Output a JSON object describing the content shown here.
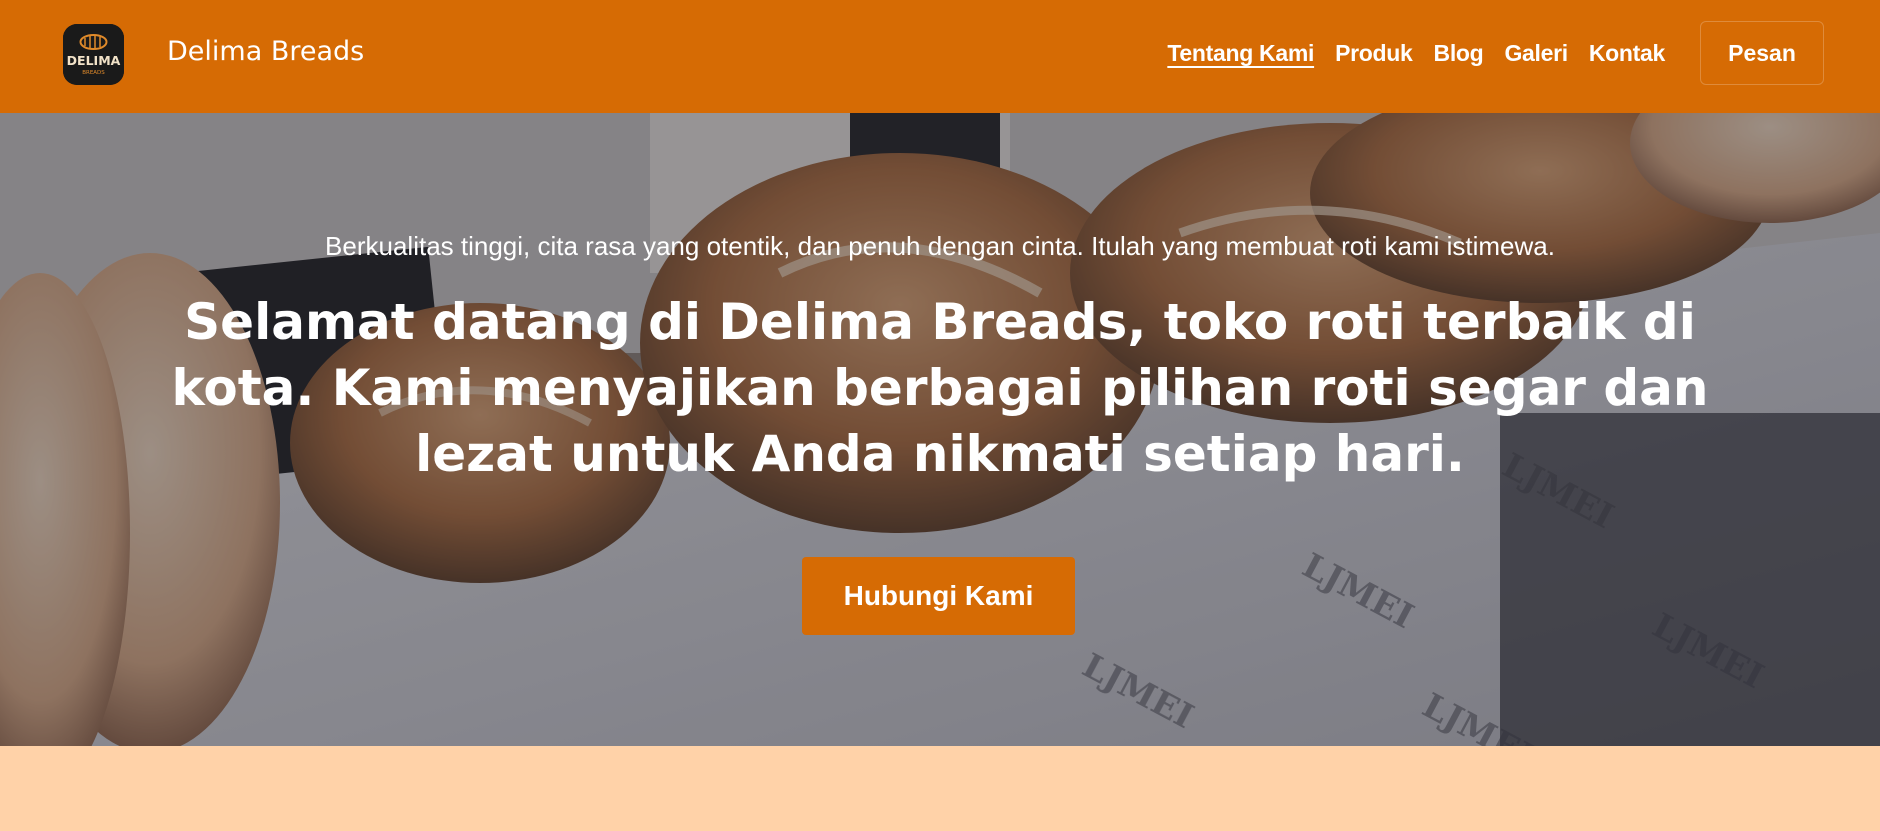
{
  "navbar": {
    "brand": "Delima Breads",
    "logo_text": "DELIMA",
    "logo_subtext": "BREADS",
    "links": [
      {
        "label": "Tentang Kami",
        "active": true
      },
      {
        "label": "Produk",
        "active": false
      },
      {
        "label": "Blog",
        "active": false
      },
      {
        "label": "Galeri",
        "active": false
      },
      {
        "label": "Kontak",
        "active": false
      }
    ],
    "order_label": "Pesan"
  },
  "hero": {
    "tagline": "Berkualitas tinggi, cita rasa yang otentik, dan penuh dengan cinta. Itulah yang membuat roti kami istimewa.",
    "headline": "Selamat datang di Delima Breads, toko roti terbaik di kota. Kami menyajikan berbagai pilihan roti segar dan lezat untuk Anda nikmati setiap hari.",
    "cta_label": "Hubungi Kami"
  },
  "colors": {
    "accent": "#d66b04",
    "section_bg": "#ffd2a8"
  }
}
